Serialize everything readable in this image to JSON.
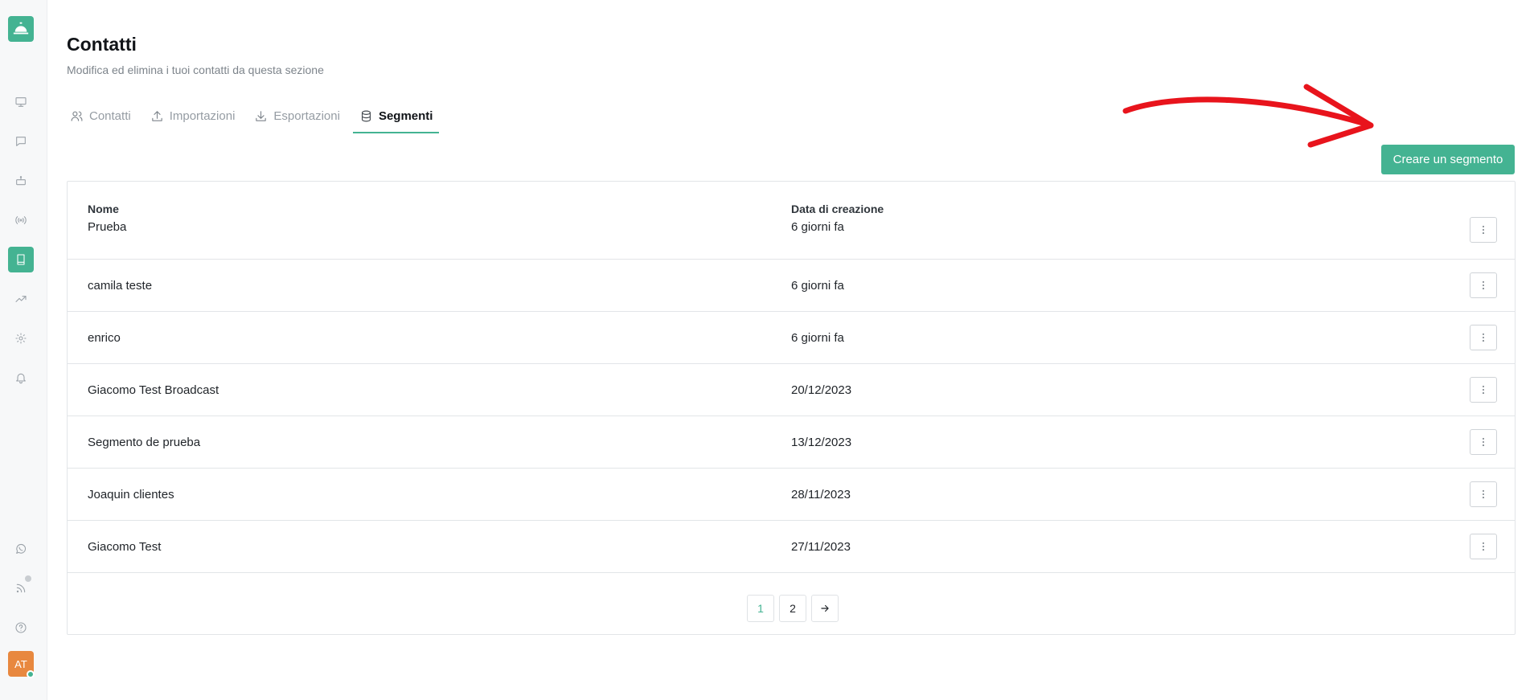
{
  "sidebar": {
    "nav_icons": [
      "monitor-icon",
      "chat-icon",
      "bot-icon",
      "broadcast-icon",
      "contacts-book-icon",
      "trend-chart-icon",
      "settings-gear-icon",
      "bell-icon"
    ],
    "bottom_icons": [
      "whatsapp-icon",
      "rss-icon",
      "help-icon"
    ],
    "active_item": "contacts-book-icon",
    "avatar_initials": "AT"
  },
  "header": {
    "title": "Contatti",
    "subtitle": "Modifica ed elimina i tuoi contatti da questa sezione"
  },
  "tabs": [
    {
      "label": "Contatti",
      "icon": "users-icon",
      "active": false
    },
    {
      "label": "Importazioni",
      "icon": "upload-icon",
      "active": false
    },
    {
      "label": "Esportazioni",
      "icon": "download-icon",
      "active": false
    },
    {
      "label": "Segmenti",
      "icon": "database-icon",
      "active": true
    }
  ],
  "actions": {
    "create_segment_label": "Creare un segmento"
  },
  "table": {
    "columns": [
      "Nome",
      "Data di creazione"
    ],
    "rows": [
      {
        "name": "Prueba",
        "created": "6 giorni fa"
      },
      {
        "name": "camila teste",
        "created": "6 giorni fa"
      },
      {
        "name": "enrico",
        "created": "6 giorni fa"
      },
      {
        "name": "Giacomo Test Broadcast",
        "created": "20/12/2023"
      },
      {
        "name": "Segmento de prueba",
        "created": "13/12/2023"
      },
      {
        "name": "Joaquin clientes",
        "created": "28/11/2023"
      },
      {
        "name": "Giacomo Test",
        "created": "27/11/2023"
      }
    ]
  },
  "pagination": {
    "pages": [
      "1",
      "2"
    ],
    "current": "1"
  },
  "colors": {
    "accent": "#44b392",
    "avatar": "#e8883f",
    "annotation": "#e8141c"
  }
}
